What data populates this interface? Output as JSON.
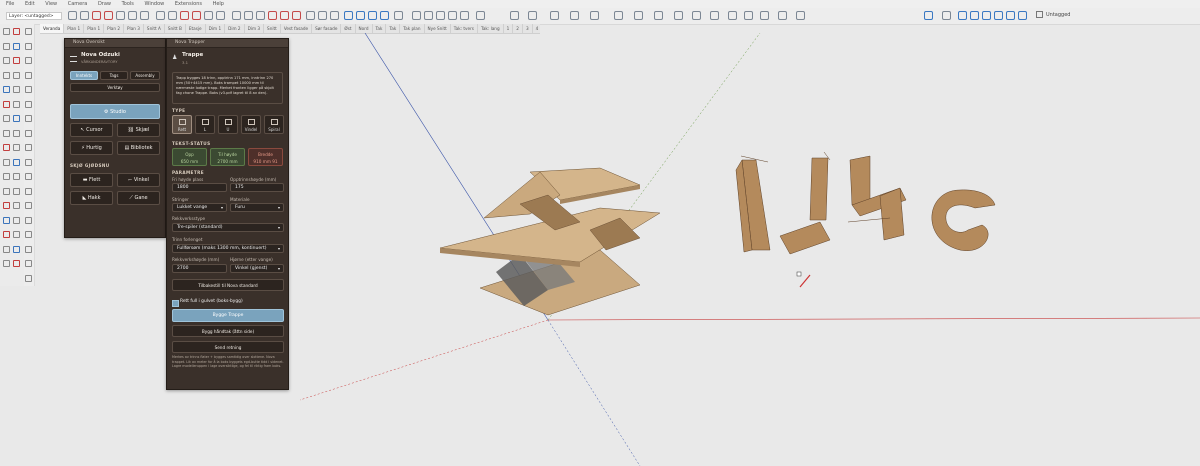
{
  "menu": [
    "File",
    "Edit",
    "View",
    "Camera",
    "Draw",
    "Tools",
    "Window",
    "Extensions",
    "Help"
  ],
  "layer_field": "Layer: <untagged>",
  "tag_selector": "Untagged",
  "tabs": [
    "Veranda",
    "Plan 1",
    "Plan 1",
    "Plan 2",
    "Plan 3",
    "Snitt A",
    "Snitt B",
    "Etasje",
    "Dim 1",
    "Dim 2",
    "Dim 3",
    "Snitt",
    "Vest fasade",
    "Sør fasade",
    "Øst",
    "Nord",
    "Tak",
    "Tak",
    "Tak plan",
    "Nye Snitt",
    "Tak: tvers",
    "Tak: lang",
    "1",
    "2",
    "3",
    "4"
  ],
  "panel1": {
    "title": "Nova Oversikt",
    "brand": "Nova Odzuki",
    "subtitle": "VÅRKANDERAVTORY",
    "tabs": [
      "Inntekts",
      "Tags",
      "Assembly",
      "Verktøy"
    ],
    "studio": "Studio",
    "grid": [
      "Cursor",
      "Skjæl",
      "Hurtig",
      "Bibliotek"
    ],
    "section": "SKJØ GJØDSNU",
    "grid2": [
      "Flett",
      "Vinkel",
      "Hakk",
      "Gane"
    ]
  },
  "panel2": {
    "title": "Nova Trapper",
    "heading": "Trappe",
    "heading_sub": "3.1",
    "description": "Trapp bygges 18 trinn, opptrinn 171 mm, inntrinn 270 mm (50+4415 mm). Boks trampet 10000 mm til nærmeste lodige trapp. Merket fronten ligger på skjolt fag chone Trappe. Boks (v3.pdf lagret til 8 av den).",
    "type_label": "TYPE",
    "types": [
      "Rett",
      "L",
      "U",
      "Vindel",
      "Spiral"
    ],
    "status_label": "TEKST-STATUS",
    "stats": [
      {
        "k": "Opp",
        "v": "650 mm"
      },
      {
        "k": "Til høyde",
        "v": "2700 mm"
      },
      {
        "k": "Bredde",
        "v": "910 mm 91"
      }
    ],
    "param_label": "PARAMETRE",
    "f1_label": "Fri høyde plass",
    "f1_value": "1800",
    "f2_label": "Opptrinnshøyde (mm)",
    "f2_value": "175",
    "f3_label": "Stringer",
    "f3_value": "Lukket vange",
    "f4_label": "Materiale",
    "f4_value": "Furu",
    "f5_label": "Rekkverksstype",
    "f5_value": "Tre-spiler (standard)",
    "f6_label": "Trinn forlenget",
    "f6_value": "Fullførsøm (maks 1300 mm, kontinuert)",
    "f7_label": "Rekkverkshøyde (mm)",
    "f7_value": "2700",
    "f8_label": "Hjørne (etter vange)",
    "f8_value": "Vinkel (gjenst)",
    "reset_button": "Tilbakestill til Nova standard",
    "checkbox_label": "Rett full i gulvet (boks-bygg)",
    "primary_button": "Bygge Trappe",
    "secondary_button": "Bygg håndtak (åttn side)",
    "tertiary_button": "Send retning",
    "footnote": "Merkes av trinns flater + bygges samtidig over slottene. Nova trappet. Lik av meter for å la boks byggets egd-butte tidd i sidenet. Lagre modelleruppen i lage oversiktlige, og fel til riktig fram boks."
  }
}
